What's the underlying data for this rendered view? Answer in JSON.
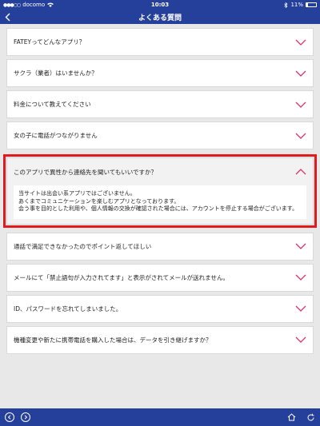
{
  "status_bar": {
    "signal": "●●●○○",
    "carrier": "docomo",
    "time": "10:03",
    "battery": "11%"
  },
  "nav": {
    "title": "よくある質問"
  },
  "faq": {
    "items": [
      {
        "question": "FATEYってどんなアプリ？"
      },
      {
        "question": "サクラ（業者）はいませんか？"
      },
      {
        "question": "料金について教えてください"
      },
      {
        "question": "女の子に電話がつながりません"
      },
      {
        "question": "このアプリで異性から連絡先を聞いてもいいですか？",
        "answer": [
          "当サイトは出会い系アプリではございません。",
          "あくまでコミュニケーションを楽しむアプリとなっております。",
          "会う事を目的とした利用や、個人情報の交換が確認された場合には、アカウントを停止する場合がございます。"
        ]
      },
      {
        "question": "通話で満足できなかったのでポイント返してほしい"
      },
      {
        "question": "メールにて「禁止語句が入力されてます」と表示がされてメールが送れません。"
      },
      {
        "question": "ID、パスワードを忘れてしまいました。"
      },
      {
        "question": "機種変更や新たに携帯電話を購入した場合は、データを引き継げますか？"
      }
    ]
  },
  "colors": {
    "nav": "#25409a",
    "chevron": "#d6336c",
    "highlight": "#e11b1b"
  }
}
